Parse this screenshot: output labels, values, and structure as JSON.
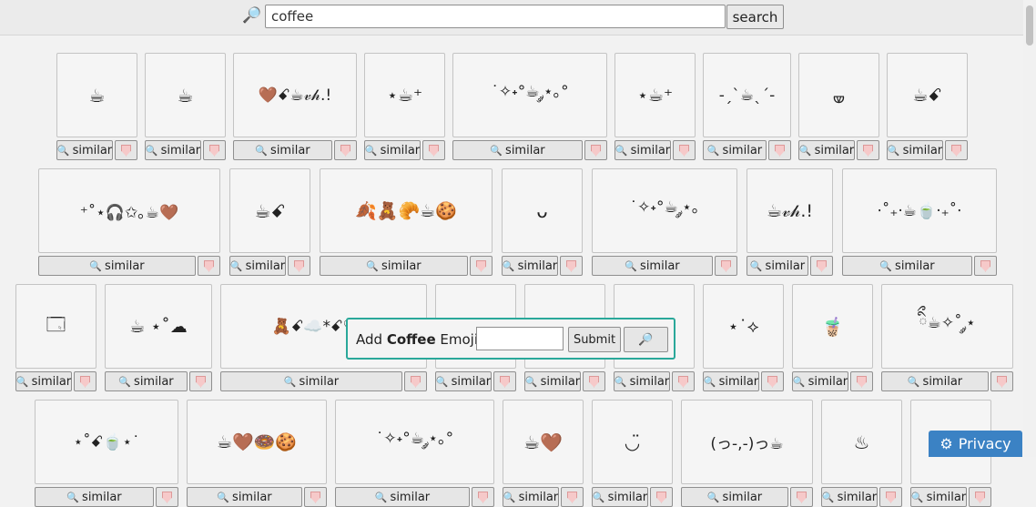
{
  "search": {
    "value": "coffee",
    "button_label": "search"
  },
  "similar_label": "similar",
  "add_box": {
    "prefix": "Add ",
    "keyword": "Coffee",
    "suffix": " Emoji:",
    "submit_label": "Submit"
  },
  "privacy_label": "Privacy",
  "rows": [
    [
      {
        "text": "☕︎",
        "w": 89
      },
      {
        "text": "☕",
        "w": 89
      },
      {
        "text": "🤎ꗃ☕︎𝓋𝒽.!",
        "w": 136
      },
      {
        "text": "⋆☕︎⁺",
        "w": 89
      },
      {
        "text": "˙✧˖°☕ ༘⋆｡°",
        "w": 170
      },
      {
        "text": "⋆☕︎⁺",
        "w": 89
      },
      {
        "text": "-ˏˋ☕ˎˊ-",
        "w": 97
      },
      {
        "text": "🝦",
        "w": 89
      },
      {
        "text": "☕︎ꗃ",
        "w": 89
      }
    ],
    [
      {
        "text": "⁺˚⋆🎧✩｡☕🤎",
        "w": 200
      },
      {
        "text": "☕ꗃ",
        "w": 89
      },
      {
        "text": "🍂🧸🥐☕🍪",
        "w": 190
      },
      {
        "text": "ᴗ",
        "w": 89
      },
      {
        "text": "˙✧˖°☕ ༘⋆｡",
        "w": 160
      },
      {
        "text": "☕𝓋𝒽.!",
        "w": 95
      },
      {
        "text": "⋅˚₊‧☕︎🍵‧₊˚⋅",
        "w": 170
      }
    ],
    [
      {
        "text": "🗔",
        "w": 89
      },
      {
        "text": "☕ ⋆˚☁",
        "w": 118
      },
      {
        "text": "🧸ꗃ☁️*ꗃ♡ ☕",
        "w": 227
      },
      {
        "text": "",
        "w": 89
      },
      {
        "text": "",
        "w": 89
      },
      {
        "text": "",
        "w": 89
      },
      {
        "text": "⋆˙⟡",
        "w": 89
      },
      {
        "text": "🧋",
        "w": 89
      },
      {
        "text": "ིྀ☕✧˚ ༘⋆",
        "w": 145
      }
    ],
    [
      {
        "text": "⋆˚ꗃ🍵⋆˙",
        "w": 158
      },
      {
        "text": "☕🤎🍩🍪",
        "w": 154
      },
      {
        "text": "˙✧˖°☕ ༘⋆｡°",
        "w": 175
      },
      {
        "text": "☕🤎",
        "w": 89
      },
      {
        "text": "◡̈",
        "w": 89
      },
      {
        "text": "(っ-,-)っ☕",
        "w": 145
      },
      {
        "text": "♨",
        "w": 89
      },
      {
        "text": "˚ᐟ",
        "w": 89
      }
    ]
  ]
}
